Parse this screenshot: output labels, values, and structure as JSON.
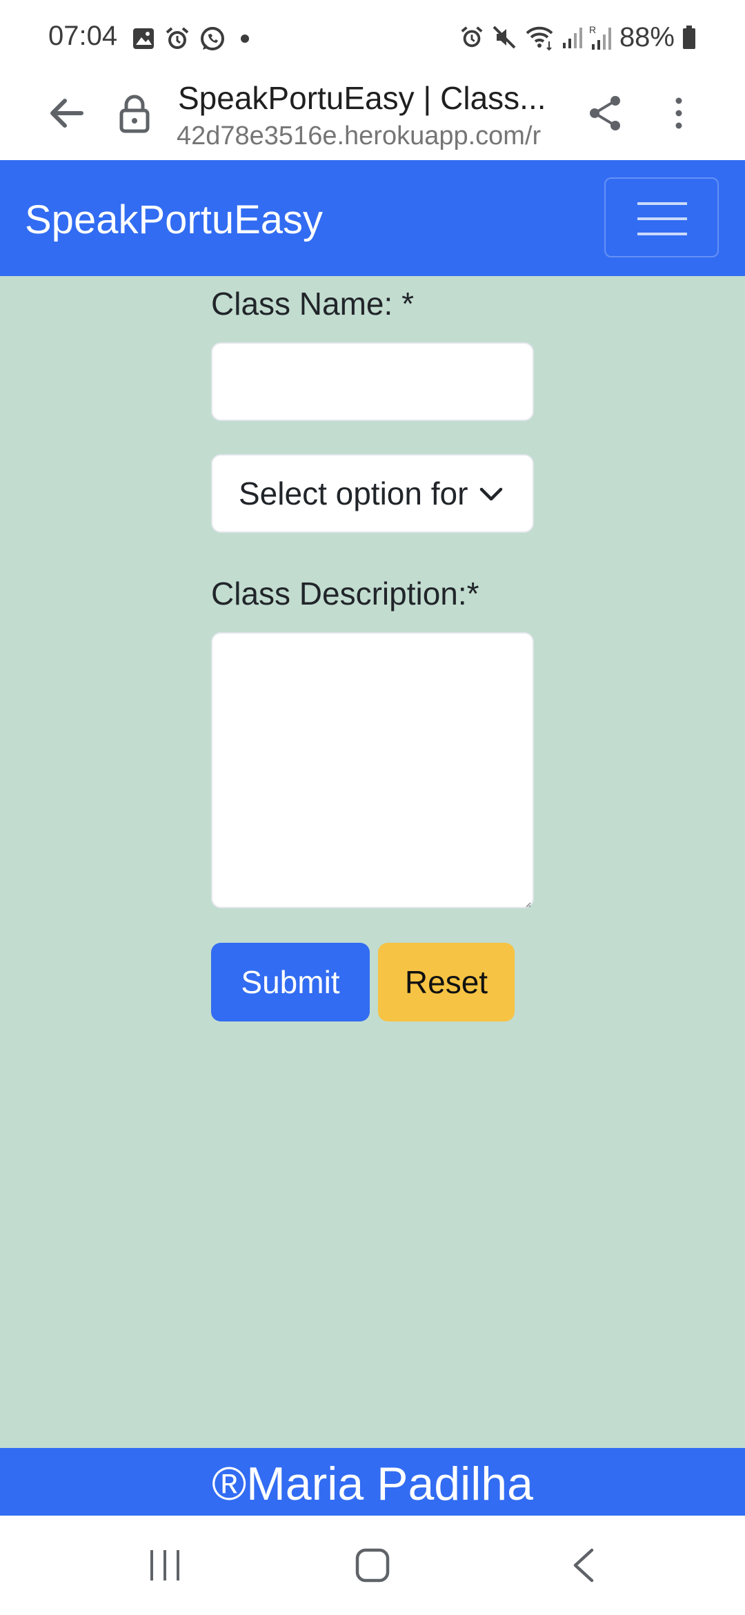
{
  "status_bar": {
    "time": "07:04",
    "battery": "88%",
    "left_icons": [
      "gallery-icon",
      "alarm-icon",
      "whatsapp-icon",
      "dot-icon"
    ],
    "right_icons": [
      "alarm-icon",
      "mute-icon",
      "wifi-icon",
      "signal-icon",
      "signal-roaming-icon",
      "battery-icon"
    ]
  },
  "browser": {
    "title": "SpeakPortuEasy | Class...",
    "url": "42d78e3516e.herokuapp.com/r"
  },
  "navbar": {
    "brand": "SpeakPortuEasy"
  },
  "form": {
    "class_name_label": "Class Name: *",
    "class_name_value": "",
    "select_text": "Select option for",
    "description_label": "Class Description:*",
    "description_value": "",
    "submit_label": "Submit",
    "reset_label": "Reset"
  },
  "footer": {
    "text": "®Maria Padilha"
  },
  "colors": {
    "primary": "#326cf2",
    "warning": "#f6c344",
    "background": "#c2dcd0"
  }
}
